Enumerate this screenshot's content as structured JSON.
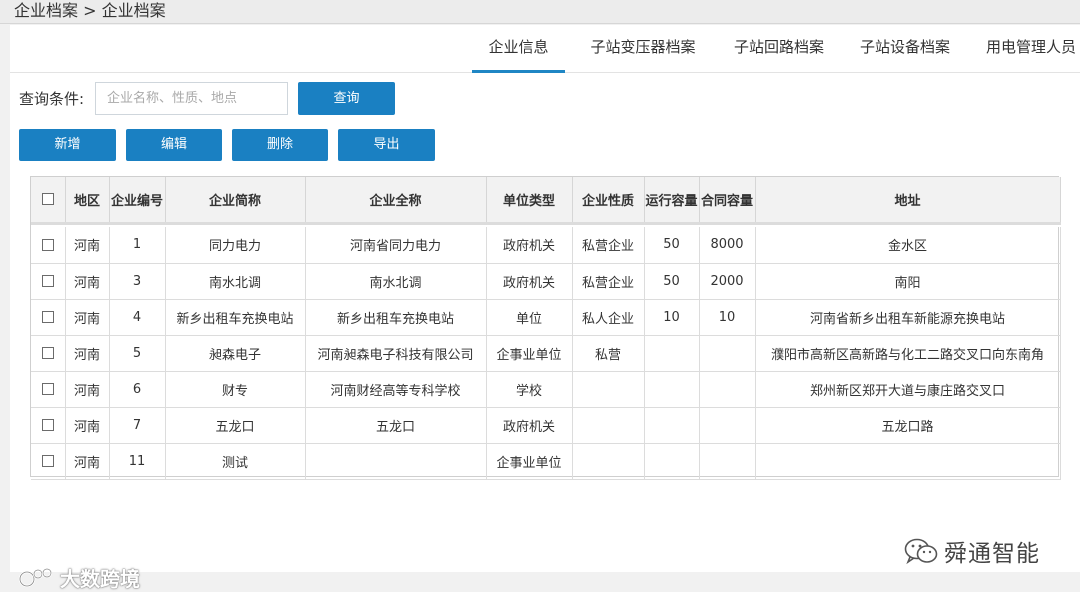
{
  "breadcrumb": "企业档案 > 企业档案",
  "tabs": [
    {
      "label": "企业信息"
    },
    {
      "label": "子站变压器档案"
    },
    {
      "label": "子站回路档案"
    },
    {
      "label": "子站设备档案"
    },
    {
      "label": "用电管理人员"
    }
  ],
  "active_tab": "企业信息",
  "query": {
    "label": "查询条件:",
    "placeholder": "企业名称、性质、地点",
    "value": "",
    "button_label": "查询"
  },
  "toolbar": {
    "add_label": "新增",
    "edit_label": "编辑",
    "delete_label": "删除",
    "export_label": "导出"
  },
  "table": {
    "columns": [
      "地区",
      "企业编号",
      "企业简称",
      "企业全称",
      "单位类型",
      "企业性质",
      "运行容量",
      "合同容量",
      "地址"
    ],
    "rows": [
      [
        "河南",
        "1",
        "同力电力",
        "河南省同力电力",
        "政府机关",
        "私营企业",
        "50",
        "8000",
        "金水区"
      ],
      [
        "河南",
        "3",
        "南水北调",
        "南水北调",
        "政府机关",
        "私营企业",
        "50",
        "2000",
        "南阳"
      ],
      [
        "河南",
        "4",
        "新乡出租车充换电站",
        "新乡出租车充换电站",
        "单位",
        "私人企业",
        "10",
        "10",
        "河南省新乡出租车新能源充换电站"
      ],
      [
        "河南",
        "5",
        "昶森电子",
        "河南昶森电子科技有限公司",
        "企事业单位",
        "私营",
        "",
        "",
        "濮阳市高新区高新路与化工二路交叉口向东南角"
      ],
      [
        "河南",
        "6",
        "财专",
        "河南财经高等专科学校",
        "学校",
        "",
        "",
        "",
        "郑州新区郑开大道与康庄路交叉口"
      ],
      [
        "河南",
        "7",
        "五龙口",
        "五龙口",
        "政府机关",
        "",
        "",
        "",
        "五龙口路"
      ],
      [
        "河南",
        "11",
        "测试",
        "",
        "企事业单位",
        "",
        "",
        "",
        ""
      ]
    ]
  },
  "watermarks": {
    "right": "舜通智能",
    "left": "大数跨境"
  },
  "colors": {
    "accent": "#1a80c2",
    "tab_underline": "#1f86c4"
  }
}
